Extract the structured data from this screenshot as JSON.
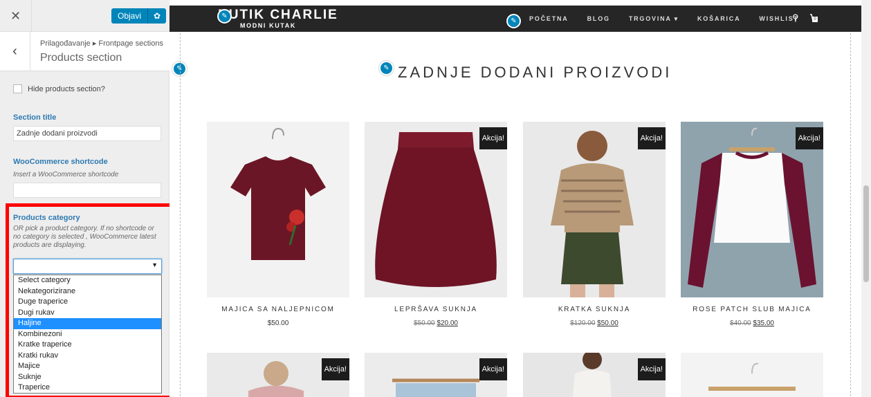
{
  "sidebar": {
    "close_icon": "✕",
    "publish_label": "Objavi",
    "back_icon": "‹",
    "breadcrumb": "Prilagođavanje ▸ Frontpage sections",
    "section_title": "Products section",
    "hide_label": "Hide products section?",
    "section_title_label": "Section title",
    "section_title_value": "Zadnje dodani proizvodi",
    "shortcode_label": "WooCommerce shortcode",
    "shortcode_desc": "Insert a WooCommerce shortcode",
    "category_label": "Products category",
    "category_desc": "OR pick a product category. If no shortcode or no category is selected , WooCommerce latest products are displaying.",
    "category_options": [
      "Select category",
      "Nekategorizirane",
      "Duge traperice",
      "Dugi rukav",
      "Haljine",
      "Kombinezoni",
      "Kratke traperice",
      "Kratki rukav",
      "Majice",
      "Suknje",
      "Traperice"
    ],
    "highlighted_option": "Haljine"
  },
  "preview": {
    "logo": "BUTIK CHARLIE",
    "logo_sub": "MODNI KUTAK",
    "nav": [
      "POČETNA",
      "BLOG",
      "TRGOVINA ▾",
      "KOŠARICA",
      "WISHLIST"
    ],
    "cart_count": "0",
    "heading": "ZADNJE DODANI PROIZVODI",
    "sale_label": "Akcija!",
    "products": [
      {
        "name": "MAJICA SA NALJEPNICOM",
        "price": "$50.00",
        "old_price": "",
        "sale": false
      },
      {
        "name": "LEPRŠAVA SUKNJA",
        "price": "$20.00",
        "old_price": "$50.00",
        "sale": true
      },
      {
        "name": "KRATKA SUKNJA",
        "price": "$50.00",
        "old_price": "$120.00",
        "sale": true
      },
      {
        "name": "ROSE PATCH SLUB MAJICA",
        "price": "$35.00",
        "old_price": "$40.00",
        "sale": true
      }
    ]
  },
  "colors": {
    "accent": "#0085ba",
    "highlight": "#ff0000",
    "nav_bg": "#262626",
    "selected": "#1e90ff"
  }
}
